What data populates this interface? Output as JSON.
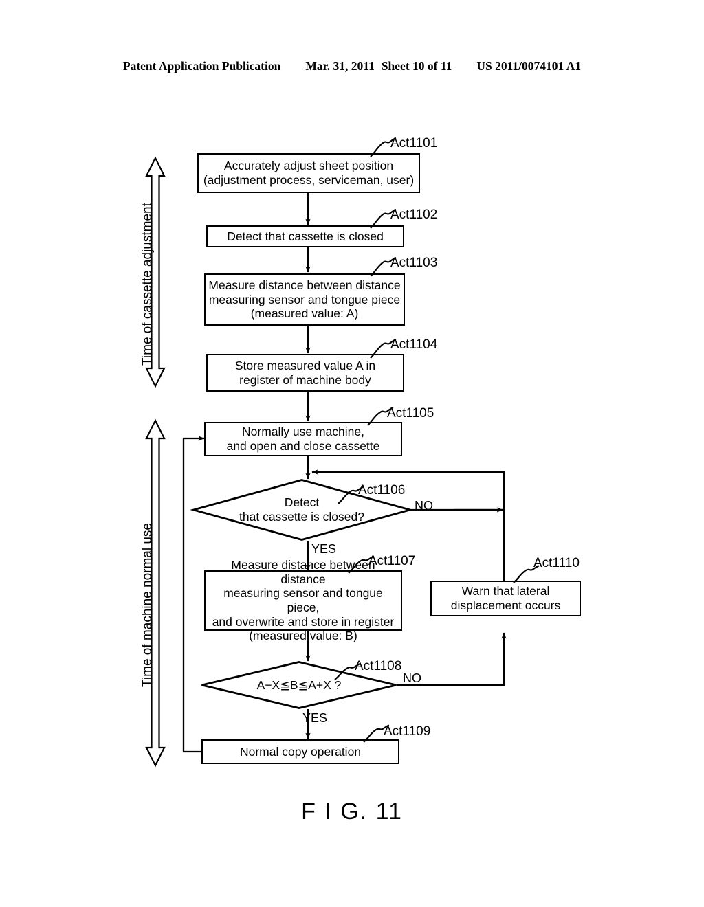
{
  "header": {
    "publication": "Patent Application Publication",
    "date": "Mar. 31, 2011",
    "sheet": "Sheet 10 of 11",
    "patent_number": "US 2011/0074101 A1"
  },
  "figure": {
    "caption": "F I G. 11"
  },
  "phases": [
    {
      "id": "phase-cassette-adjustment",
      "label": "Time of cassette adjustment"
    },
    {
      "id": "phase-machine-normal-use",
      "label": "Time of machine normal use"
    }
  ],
  "nodes": [
    {
      "id": "act1101",
      "tag": "Act1101",
      "type": "process",
      "text": "Accurately adjust sheet position\n(adjustment process, serviceman, user)"
    },
    {
      "id": "act1102",
      "tag": "Act1102",
      "type": "process",
      "text": "Detect that cassette is closed"
    },
    {
      "id": "act1103",
      "tag": "Act1103",
      "type": "process",
      "text": "Measure distance between distance\nmeasuring sensor and tongue piece\n(measured value: A)"
    },
    {
      "id": "act1104",
      "tag": "Act1104",
      "type": "process",
      "text": "Store measured value A in\nregister of machine body"
    },
    {
      "id": "act1105",
      "tag": "Act1105",
      "type": "process",
      "text": "Normally use machine,\nand open and close cassette"
    },
    {
      "id": "act1106",
      "tag": "Act1106",
      "type": "decision",
      "text": "Detect\nthat cassette is closed?"
    },
    {
      "id": "act1107",
      "tag": "Act1107",
      "type": "process",
      "text": "Measure distance between distance\nmeasuring sensor and tongue piece,\nand overwrite and store in register\n(measured value: B)"
    },
    {
      "id": "act1108",
      "tag": "Act1108",
      "type": "decision",
      "text": "A−X≦B≦A+X ?"
    },
    {
      "id": "act1109",
      "tag": "Act1109",
      "type": "process",
      "text": "Normal copy operation"
    },
    {
      "id": "act1110",
      "tag": "Act1110",
      "type": "process",
      "text": "Warn that lateral\ndisplacement occurs"
    }
  ],
  "branch_labels": [
    {
      "id": "act1106-no",
      "text": "NO"
    },
    {
      "id": "act1106-yes",
      "text": "YES"
    },
    {
      "id": "act1108-no",
      "text": "NO"
    },
    {
      "id": "act1108-yes",
      "text": "YES"
    }
  ],
  "colors": {
    "ink": "#000000",
    "paper": "#ffffff"
  }
}
